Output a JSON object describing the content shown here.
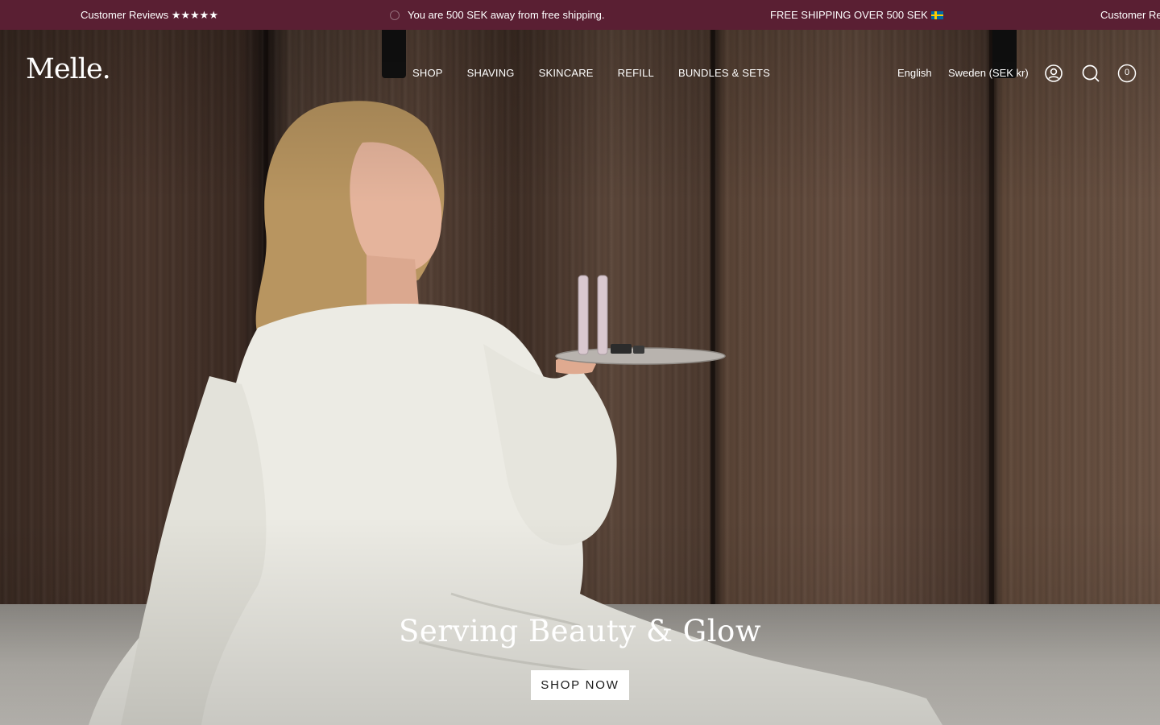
{
  "announcement_bar": {
    "items": [
      "Customer Reviews ★★★★★",
      "You are 500 SEK away from free shipping.",
      "FREE SHIPPING OVER 500 SEK",
      "Customer Re"
    ],
    "background": "#5a1f33"
  },
  "header": {
    "logo": "Melle.",
    "nav": [
      "SHOP",
      "SHAVING",
      "SKINCARE",
      "REFILL",
      "BUNDLES & SETS"
    ],
    "language": "English",
    "country": "Sweden (SEK kr)",
    "cart_count": "0",
    "icons": [
      "account-icon",
      "search-icon",
      "cart-icon"
    ]
  },
  "hero": {
    "title": "Serving Beauty & Glow",
    "button_label": "SHOP NOW"
  }
}
